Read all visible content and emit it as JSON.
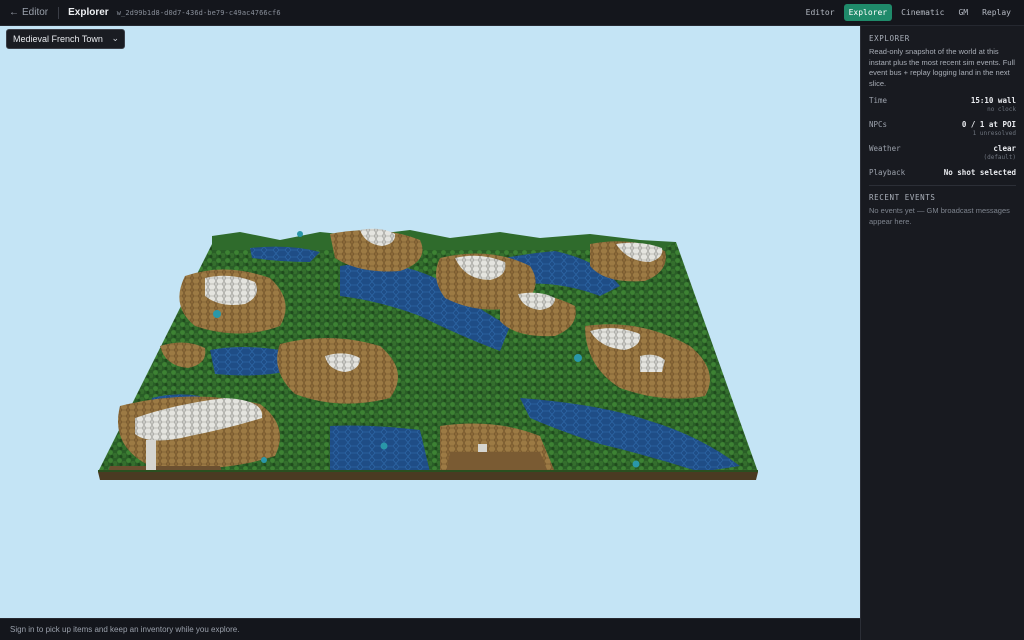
{
  "topbar": {
    "back_arrow": "←",
    "back_label": "Editor",
    "title": "Explorer",
    "world_id": "w_2d99b1d8-d0d7-436d-be79-c49ac4766cf6",
    "tabs": [
      "Editor",
      "Explorer",
      "Cinematic",
      "GM",
      "Replay"
    ],
    "active_tab": "Explorer"
  },
  "viewport": {
    "world_select": {
      "value": "Medieval French Town",
      "chevron": "⌄"
    }
  },
  "bottombar": {
    "text": "Sign in to pick up items and keep an inventory while you explore."
  },
  "sidebar": {
    "heading": "EXPLORER",
    "description": "Read-only snapshot of the world at this instant plus the most recent sim events. Full event bus + replay logging land in the next slice.",
    "rows": [
      {
        "key": "Time",
        "value": "15:10 wall",
        "sub": "no clock"
      },
      {
        "key": "NPCs",
        "value": "0 / 1 at POI",
        "sub": "1 unresolved"
      },
      {
        "key": "Weather",
        "value": "clear",
        "sub": "(default)"
      },
      {
        "key": "Playback",
        "value": "No shot selected",
        "sub": ""
      }
    ],
    "events_heading": "RECENT EVENTS",
    "events_empty": "No events yet — GM broadcast messages appear here."
  },
  "colors": {
    "sky": "#c4e4f5",
    "accent": "#1f8a6a",
    "panel": "#181a20",
    "forest": "#2f6b2c",
    "water": "#1f4d86",
    "dirt": "#8a6838",
    "stone": "#d8d8d4"
  }
}
